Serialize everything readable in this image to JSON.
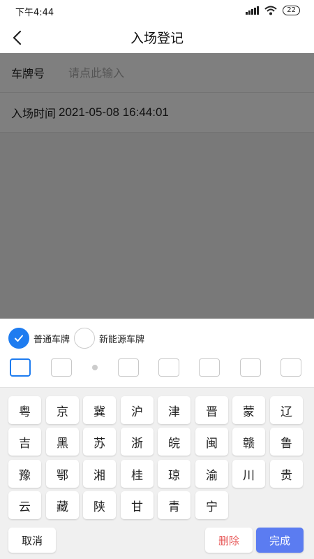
{
  "status_bar": {
    "time": "下午4:44",
    "battery": "22"
  },
  "header": {
    "title": "入场登记"
  },
  "form": {
    "plate_label": "车牌号",
    "plate_placeholder": "请点此输入",
    "entry_time_label": "入场时间",
    "entry_time_value": "2021-05-08 16:44:01"
  },
  "plate_type": {
    "options": [
      {
        "label": "普通车牌",
        "selected": true
      },
      {
        "label": "新能源车牌",
        "selected": false
      }
    ]
  },
  "keyboard": {
    "rows": [
      [
        "粤",
        "京",
        "冀",
        "沪",
        "津",
        "晋",
        "蒙",
        "辽"
      ],
      [
        "吉",
        "黑",
        "苏",
        "浙",
        "皖",
        "闽",
        "赣",
        "鲁"
      ],
      [
        "豫",
        "鄂",
        "湘",
        "桂",
        "琼",
        "渝",
        "川",
        "贵"
      ],
      [
        "云",
        "藏",
        "陕",
        "甘",
        "青",
        "宁"
      ]
    ],
    "cancel_label": "取消",
    "delete_label": "删除",
    "done_label": "完成"
  },
  "colors": {
    "accent": "#1e7cf0",
    "done_button": "#5b7cf1",
    "delete_text": "#e85c5c"
  }
}
